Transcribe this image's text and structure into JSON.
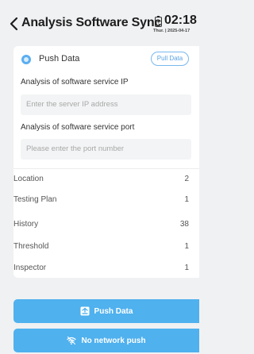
{
  "header": {
    "back_icon": "chevron-left-icon",
    "title": "Analysis Software Sync",
    "time": "02:18",
    "date": "Thur. | 2025-04-17",
    "battery_icon": "battery-icon"
  },
  "push_section": {
    "icon": "circle-dot-icon",
    "label": "Push Data",
    "pull_button": "Pull Data"
  },
  "form": {
    "ip_label": "Analysis of software service IP",
    "ip_placeholder": "Enter the server IP address",
    "ip_value": "",
    "port_label": "Analysis of software service port",
    "port_placeholder": "Please enter the port number",
    "port_value": ""
  },
  "stats": [
    {
      "name": "Location",
      "value": "2"
    },
    {
      "name": "Testing Plan",
      "value": "1"
    },
    {
      "name": "History",
      "value": "38"
    },
    {
      "name": "Threshold",
      "value": "1"
    },
    {
      "name": "Inspector",
      "value": "1"
    }
  ],
  "actions": {
    "push_label": "Push Data",
    "push_icon": "export-icon",
    "no_network_label": "No network push",
    "no_network_icon": "wifi-icon"
  },
  "colors": {
    "accent": "#4fb1ee",
    "background": "#f0f1f3",
    "card": "#ffffff"
  }
}
